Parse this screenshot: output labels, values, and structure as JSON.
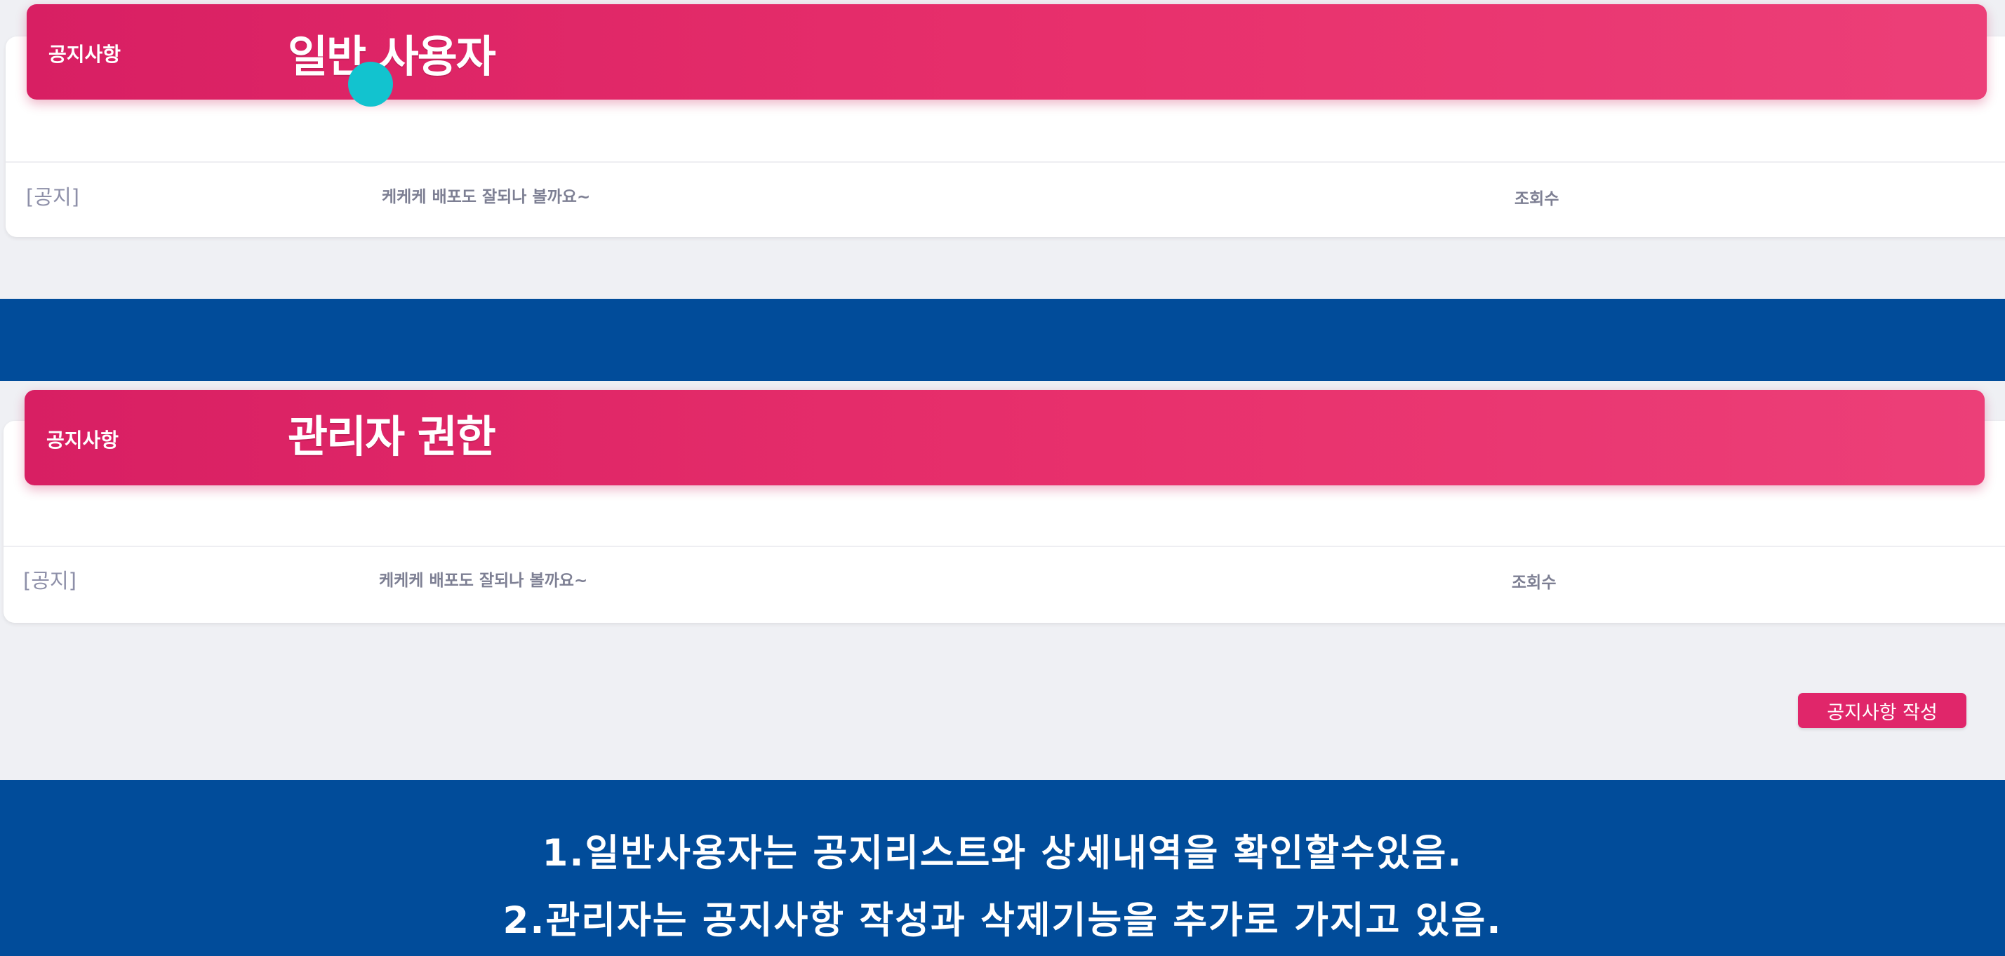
{
  "user_section": {
    "header_title": "공지사항",
    "overlay_label": "일반 사용자",
    "row": {
      "tag": "[공지]",
      "title": "케케케 배포도 잘되나 볼까요~",
      "views_label": "조회수"
    }
  },
  "admin_section": {
    "header_title": "공지사항",
    "overlay_label": "관리자 권한",
    "row": {
      "tag": "[공지]",
      "title": "케케케 배포도 잘되나 볼까요~",
      "views_label": "조회수"
    },
    "write_button": "공지사항 작성"
  },
  "notes": [
    "1.일반사용자는 공지리스트와 상세내역을 확인할수있음.",
    "2.관리자는 공지사항 작성과 삭제기능을 추가로 가지고 있음."
  ],
  "colors": {
    "accent": "#e0266a",
    "band": "#014c9a",
    "background": "#eff0f4",
    "cursor": "#12c3cf"
  }
}
